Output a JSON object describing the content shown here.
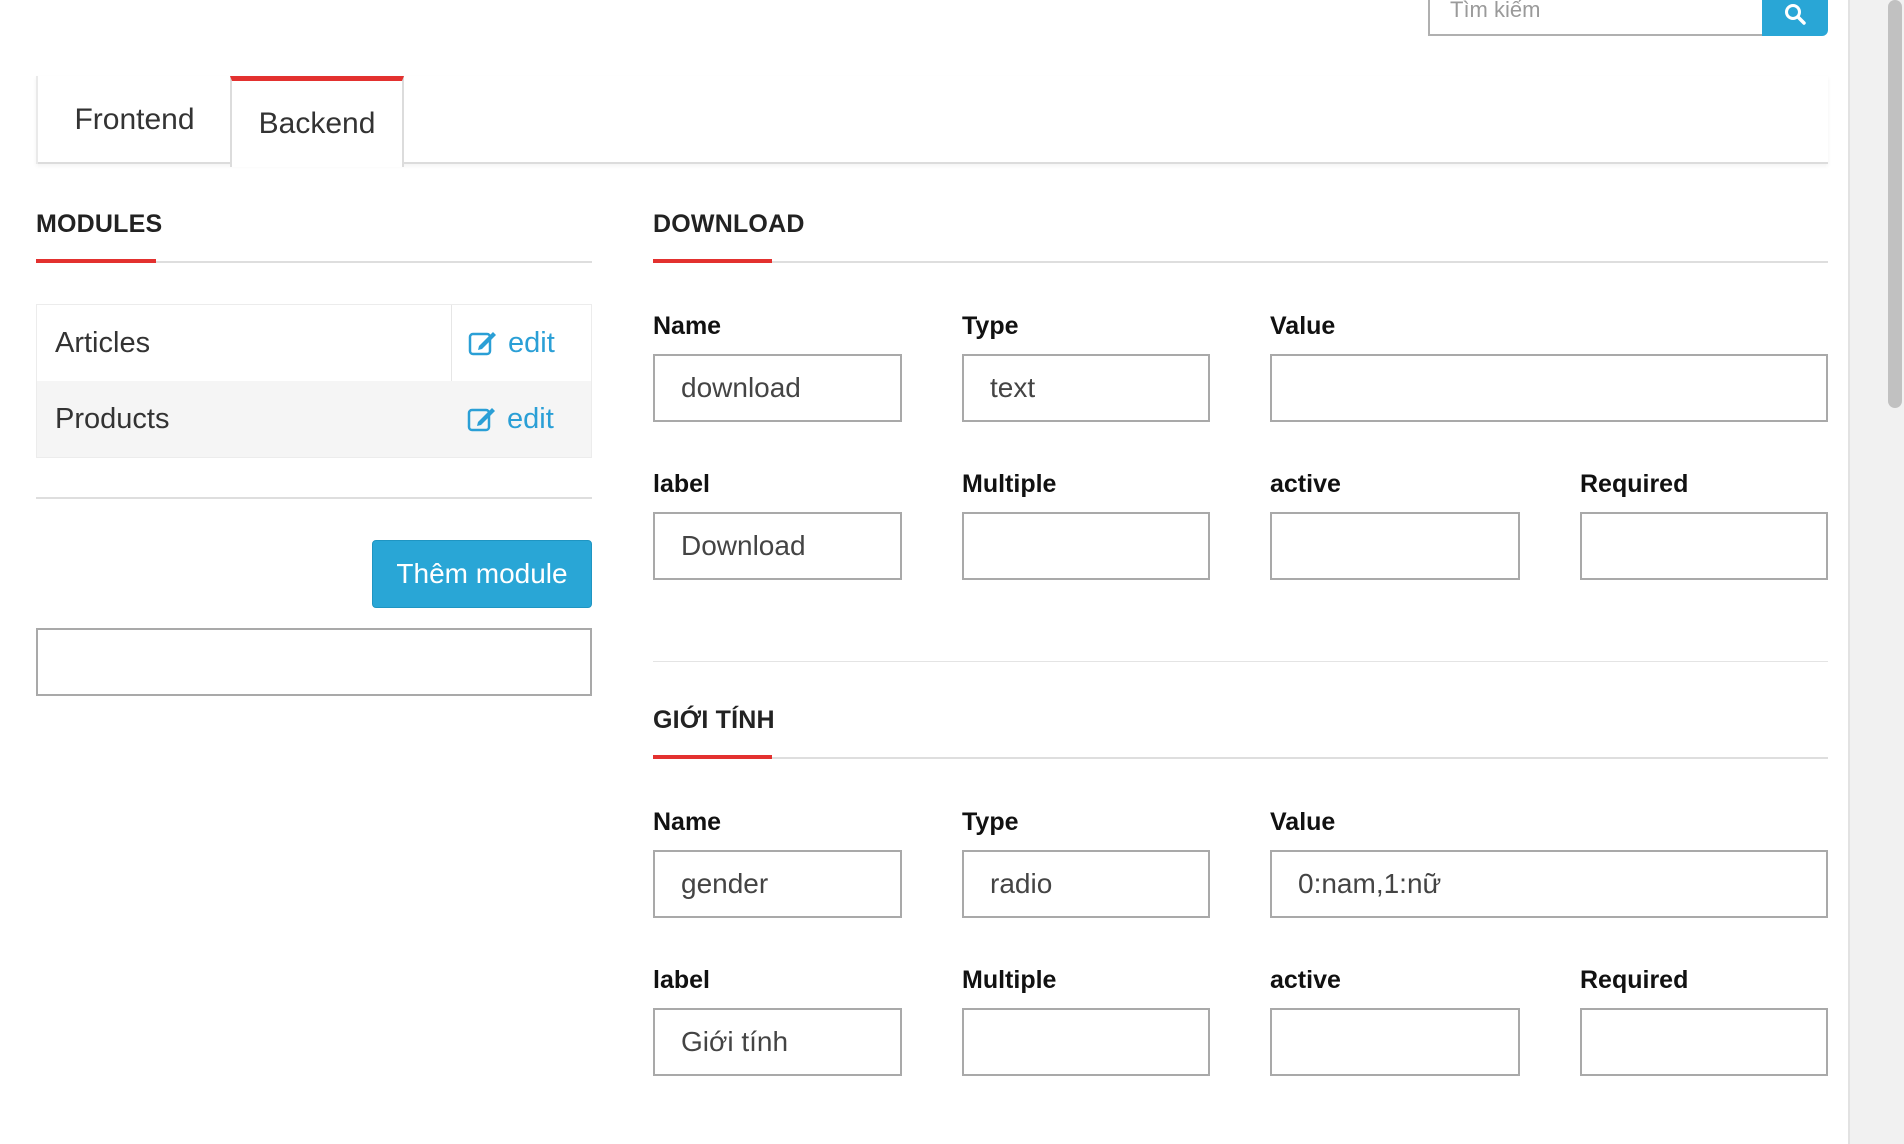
{
  "search": {
    "placeholder": "Tìm kiếm",
    "icon": "search-icon"
  },
  "tabs": [
    {
      "label": "Frontend"
    },
    {
      "label": "Backend",
      "active": true
    }
  ],
  "modules": {
    "title": "MODULES",
    "items": [
      {
        "name": "Articles",
        "edit_label": "edit"
      },
      {
        "name": "Products",
        "edit_label": "edit"
      }
    ],
    "add_button": "Thêm module",
    "new_module_value": ""
  },
  "field_labels": {
    "name": "Name",
    "type": "Type",
    "value": "Value",
    "label": "label",
    "multiple": "Multiple",
    "active": "active",
    "required": "Required"
  },
  "fields": [
    {
      "title": "DOWNLOAD",
      "name": "download",
      "type": "text",
      "value": "",
      "label": "Download",
      "multiple": "",
      "active": "",
      "required": ""
    },
    {
      "title": "GIỚI TÍNH",
      "name": "gender",
      "type": "radio",
      "value": "0:nam,1:nữ",
      "label": "Giới tính",
      "multiple": "",
      "active": "",
      "required": ""
    }
  ],
  "colors": {
    "accent": "#e3312f",
    "primary": "#29a6d6",
    "link": "#2a9fd6"
  }
}
